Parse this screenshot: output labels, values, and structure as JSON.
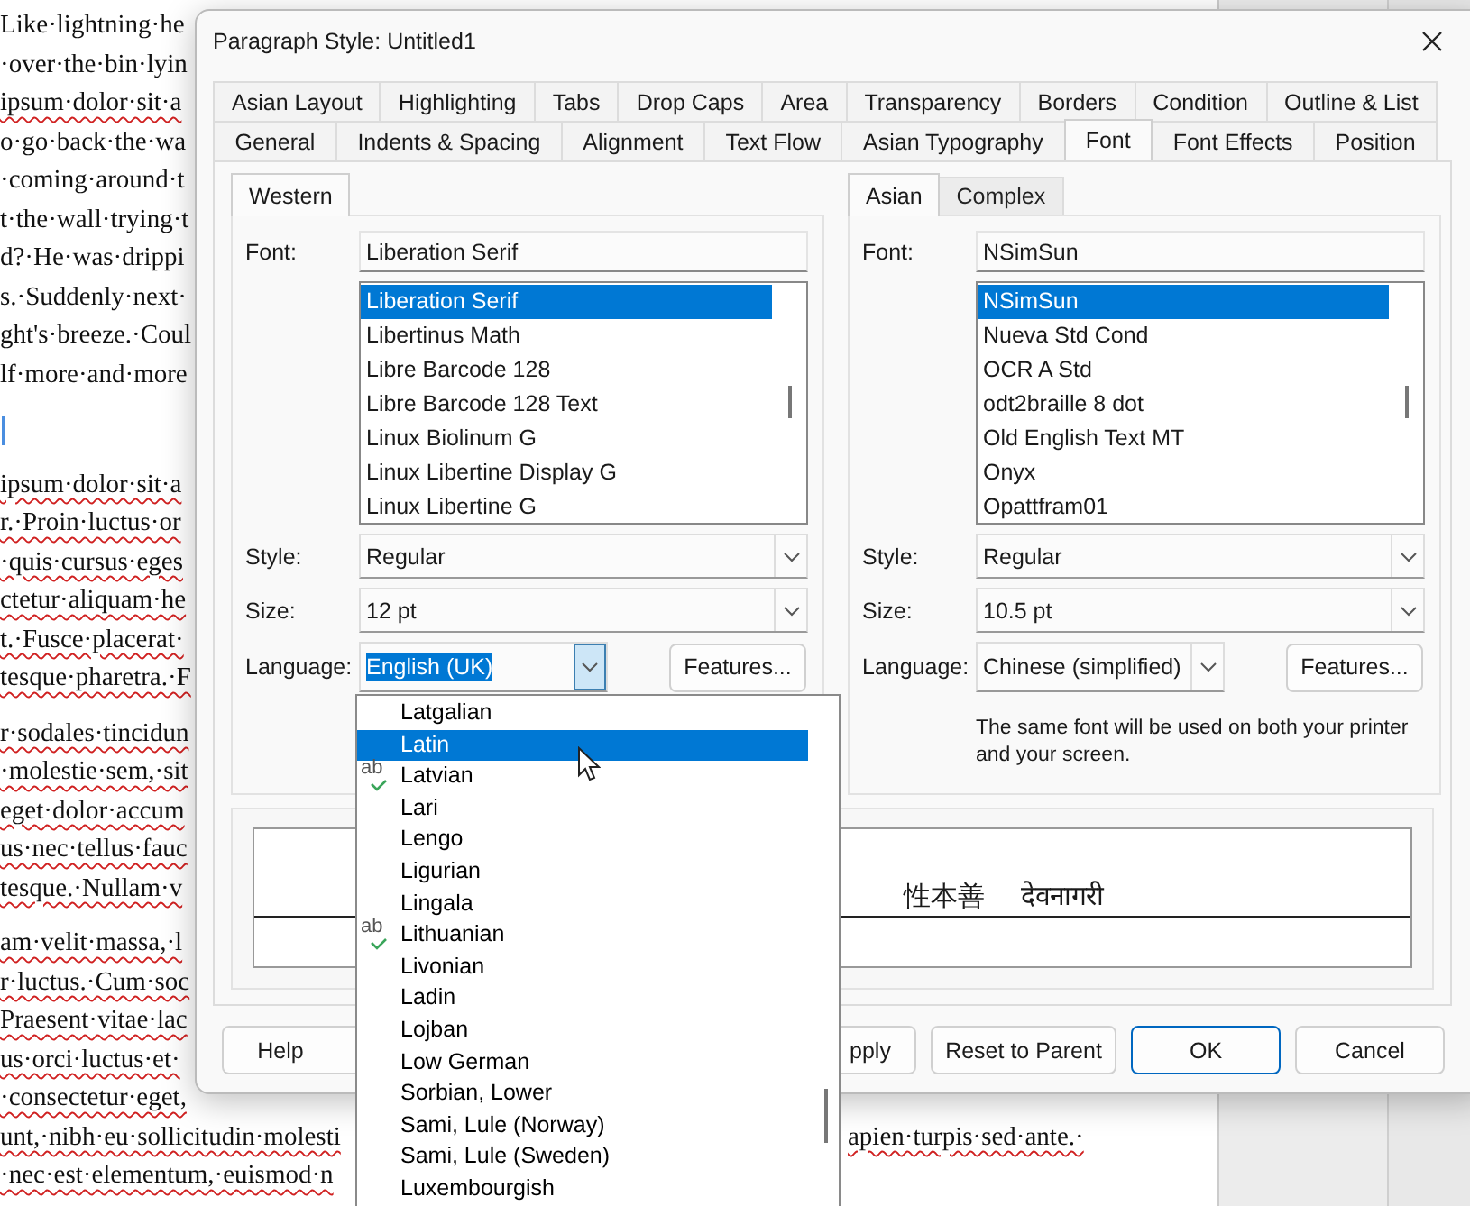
{
  "document": {
    "paragraphs": [
      {
        "kind": "text",
        "lines": [
          {
            "parts": [
              "  Like·lightning·he"
            ],
            "flagged": false
          },
          {
            "parts": [
              "·over·the·bin·lyin"
            ],
            "flagged": false
          },
          {
            "parts": [
              "ipsum·dolor·sit·a"
            ],
            "flagged": true
          },
          {
            "parts": [
              "o·go·back·the·wa"
            ],
            "flagged": false
          },
          {
            "parts": [
              "·coming·around·t"
            ],
            "flagged": false
          },
          {
            "parts": [
              "t·the·wall·trying·t"
            ],
            "flagged": false
          },
          {
            "parts": [
              "d?·He·was·drippi"
            ],
            "flagged": false
          },
          {
            "parts": [
              "s.·Suddenly·next·"
            ],
            "flagged": false
          },
          {
            "parts": [
              "ght's·breeze.·Coul"
            ],
            "flagged": false
          },
          {
            "parts": [
              "lf·more·and·more"
            ],
            "flagged": false
          }
        ]
      },
      {
        "kind": "empty"
      },
      {
        "kind": "text",
        "lines": [
          {
            "parts": [
              "ipsum·dolor·sit·a"
            ],
            "flagged": true
          },
          {
            "parts": [
              "r.·Proin·luctus·or"
            ],
            "flagged": true
          },
          {
            "parts": [
              "·quis·cursus·eges"
            ],
            "flagged": true
          },
          {
            "parts": [
              "ctetur·aliquam·he"
            ],
            "flagged": true
          },
          {
            "parts": [
              "t.·Fusce·placerat·"
            ],
            "flagged": true
          },
          {
            "parts": [
              "tesque·pharetra.·F"
            ],
            "flagged": true
          }
        ]
      },
      {
        "kind": "text",
        "lines": [
          {
            "parts": [
              "r·sodales·tincidun"
            ],
            "flagged": true
          },
          {
            "parts": [
              "·molestie·sem,·sit"
            ],
            "flagged": true
          },
          {
            "parts": [
              "eget·dolor·accum"
            ],
            "flagged": true
          },
          {
            "parts": [
              "us·nec·tellus·fauc"
            ],
            "flagged": true
          },
          {
            "parts": [
              "tesque.·Nullam·v"
            ],
            "flagged": true
          }
        ]
      },
      {
        "kind": "text",
        "lines": [
          {
            "parts": [
              "am·velit·massa,·l"
            ],
            "flagged": true
          },
          {
            "parts": [
              "r·luctus.·Cum·soc"
            ],
            "flagged": true
          },
          {
            "parts": [
              "Praesent·vitae·lac"
            ],
            "flagged": true
          },
          {
            "parts": [
              "us·orci·luctus·et·"
            ],
            "flagged": true
          },
          {
            "parts": [
              "·consectetur·eget,"
            ],
            "flagged": true
          },
          {
            "parts": [
              "unt,·nibh·eu·sollicitudin·molesti",
              "apien·turpis·sed·ante.·"
            ],
            "flagged": true
          },
          {
            "parts": [
              "·nec·est·elementum,·euismod·n"
            ],
            "flagged": true
          }
        ]
      }
    ]
  },
  "dialog": {
    "title": "Paragraph Style: Untitled1",
    "tab_rows": [
      [
        {
          "label": "Asian Layout",
          "selected": false
        },
        {
          "label": "Highlighting",
          "selected": false
        },
        {
          "label": "Tabs",
          "selected": false
        },
        {
          "label": "Drop Caps",
          "selected": false
        },
        {
          "label": "Area",
          "selected": false
        },
        {
          "label": "Transparency",
          "selected": false
        },
        {
          "label": "Borders",
          "selected": false
        },
        {
          "label": "Condition",
          "selected": false
        },
        {
          "label": "Outline & List",
          "selected": false
        }
      ],
      [
        {
          "label": "General",
          "selected": false
        },
        {
          "label": "Indents & Spacing",
          "selected": false
        },
        {
          "label": "Alignment",
          "selected": false
        },
        {
          "label": "Text Flow",
          "selected": false
        },
        {
          "label": "Asian Typography",
          "selected": false
        },
        {
          "label": "Font",
          "selected": true
        },
        {
          "label": "Font Effects",
          "selected": false
        },
        {
          "label": "Position",
          "selected": false
        }
      ]
    ],
    "panels": [
      {
        "tabs": [
          {
            "label": "Western",
            "selected": true
          }
        ],
        "font_label": "Font:",
        "font_value": "Liberation Serif",
        "font_list": [
          {
            "name": "Liberation Serif",
            "selected": true
          },
          {
            "name": "Libertinus Math",
            "selected": false
          },
          {
            "name": "Libre Barcode 128",
            "selected": false
          },
          {
            "name": "Libre Barcode 128 Text",
            "selected": false
          },
          {
            "name": "Linux Biolinum G",
            "selected": false
          },
          {
            "name": "Linux Libertine Display G",
            "selected": false
          },
          {
            "name": "Linux Libertine G",
            "selected": false
          }
        ],
        "style_label": "Style:",
        "style_value": "Regular",
        "size_label": "Size:",
        "size_value": "12 pt",
        "language_label": "Language:",
        "language_value": "English (UK)",
        "language_open": true,
        "features": "Features..."
      },
      {
        "tabs": [
          {
            "label": "Asian",
            "selected": true
          },
          {
            "label": "Complex",
            "selected": false
          }
        ],
        "font_label": "Font:",
        "font_value": "NSimSun",
        "font_list": [
          {
            "name": "NSimSun",
            "selected": true
          },
          {
            "name": "Nueva Std Cond",
            "selected": false
          },
          {
            "name": "OCR A Std",
            "selected": false
          },
          {
            "name": "odt2braille 8 dot",
            "selected": false
          },
          {
            "name": "Old English Text MT",
            "selected": false
          },
          {
            "name": "Onyx",
            "selected": false
          },
          {
            "name": "Opattfram01",
            "selected": false
          }
        ],
        "style_label": "Style:",
        "style_value": "Regular",
        "size_label": "Size:",
        "size_value": "10.5 pt",
        "language_label": "Language:",
        "language_value": "Chinese (simplified)",
        "language_open": false,
        "features": "Features...",
        "note": "The same font will be used on both your printer and your screen."
      }
    ],
    "preview": {
      "texts": [
        "性本善",
        "देवनागरी"
      ]
    },
    "buttons": [
      {
        "label": "Help",
        "default": false
      },
      {
        "label": "pply",
        "default": false
      },
      {
        "label": "Reset to Parent",
        "default": false
      },
      {
        "label": "OK",
        "default": true
      },
      {
        "label": "Cancel",
        "default": false
      }
    ]
  },
  "language_dropdown": {
    "items": [
      {
        "label": "Latgalian",
        "selected": false,
        "spellcheck": false
      },
      {
        "label": "Latin",
        "selected": true,
        "spellcheck": false
      },
      {
        "label": "Latvian",
        "selected": false,
        "spellcheck": true,
        "spellcheck_glyph": "ab"
      },
      {
        "label": "Lari",
        "selected": false,
        "spellcheck": false
      },
      {
        "label": "Lengo",
        "selected": false,
        "spellcheck": false
      },
      {
        "label": "Ligurian",
        "selected": false,
        "spellcheck": false
      },
      {
        "label": "Lingala",
        "selected": false,
        "spellcheck": false
      },
      {
        "label": "Lithuanian",
        "selected": false,
        "spellcheck": true,
        "spellcheck_glyph": "ab"
      },
      {
        "label": "Livonian",
        "selected": false,
        "spellcheck": false
      },
      {
        "label": "Ladin",
        "selected": false,
        "spellcheck": false
      },
      {
        "label": "Lojban",
        "selected": false,
        "spellcheck": false
      },
      {
        "label": "Low German",
        "selected": false,
        "spellcheck": false
      },
      {
        "label": "Sorbian, Lower",
        "selected": false,
        "spellcheck": false
      },
      {
        "label": "Sami, Lule (Norway)",
        "selected": false,
        "spellcheck": false
      },
      {
        "label": "Sami, Lule (Sweden)",
        "selected": false,
        "spellcheck": false
      },
      {
        "label": "Luxembourgish",
        "selected": false,
        "spellcheck": false
      }
    ]
  }
}
